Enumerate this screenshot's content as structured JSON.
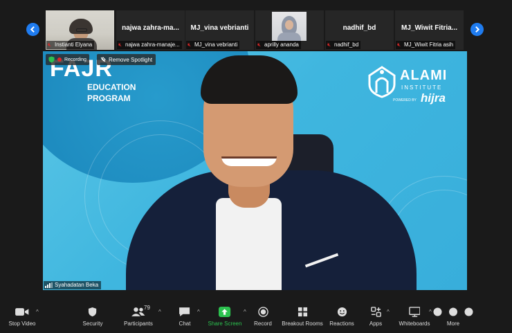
{
  "gallery": {
    "tiles": [
      {
        "name": "",
        "label": "Instianti Elyana",
        "has_video": true
      },
      {
        "name": "najwa  zahra-ma...",
        "label": "najwa zahra-manaje...",
        "has_video": false
      },
      {
        "name": "MJ_vina vebrianti",
        "label": "MJ_vina vebrianti",
        "has_video": false
      },
      {
        "name": "",
        "label": "aprilly ananda",
        "has_video": true
      },
      {
        "name": "nadhif_bd",
        "label": "nadhif_bd",
        "has_video": false
      },
      {
        "name": "MJ_Wiwit  Fitria...",
        "label": "MJ_Wiwit Fitria asih",
        "has_video": false
      }
    ]
  },
  "main": {
    "slide_title": "FAJR",
    "slide_subtitle_1": "EDUCATION",
    "slide_subtitle_2": "PROGRAM",
    "logo_name": "ALAMI",
    "logo_sub": "INSTITUTE",
    "logo_powered": "POWERED BY",
    "logo_brand": "hijra",
    "recording_label": "Recording",
    "spotlight_label": "Remove Spotlight",
    "speaker_label": "Syahadatan Beka"
  },
  "toolbar": {
    "stop_video": "Stop Video",
    "security": "Security",
    "participants": "Participants",
    "participants_count": "79",
    "chat": "Chat",
    "share_screen": "Share Screen",
    "record": "Record",
    "breakout": "Breakout Rooms",
    "reactions": "Reactions",
    "apps": "Apps",
    "whiteboards": "Whiteboards",
    "more": "More"
  },
  "colors": {
    "accent_blue": "#1f7cf0",
    "share_green": "#2cc14f",
    "mic_off_red": "#e02828",
    "slide_blue": "#3fb6df"
  }
}
